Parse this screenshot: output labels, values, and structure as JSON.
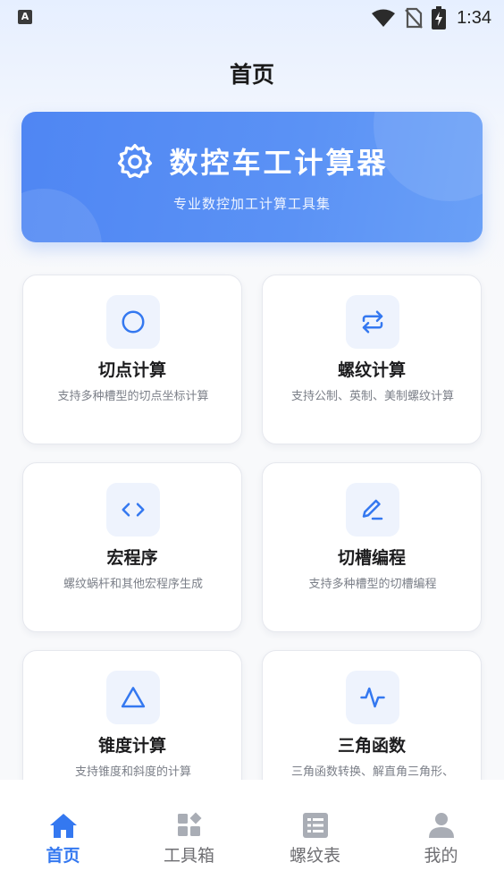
{
  "status_bar": {
    "app_icon_letter": "A",
    "time": "1:34"
  },
  "page": {
    "title": "首页"
  },
  "hero": {
    "title": "数控车工计算器",
    "subtitle": "专业数控加工计算工具集"
  },
  "cards": [
    {
      "title": "切点计算",
      "desc": "支持多种槽型的切点坐标计算",
      "icon": "circle-icon"
    },
    {
      "title": "螺纹计算",
      "desc": "支持公制、英制、美制螺纹计算",
      "icon": "swap-arrows-icon"
    },
    {
      "title": "宏程序",
      "desc": "螺纹蜗杆和其他宏程序生成",
      "icon": "code-icon"
    },
    {
      "title": "切槽编程",
      "desc": "支持多种槽型的切槽编程",
      "icon": "pencil-icon"
    },
    {
      "title": "锥度计算",
      "desc": "支持锥度和斜度的计算",
      "icon": "triangle-icon"
    },
    {
      "title": "三角函数",
      "desc": "三角函数转换、解直角三角形、",
      "icon": "waveform-icon"
    }
  ],
  "bottom_nav": {
    "items": [
      {
        "label": "首页",
        "icon": "home-icon",
        "active": true
      },
      {
        "label": "工具箱",
        "icon": "toolbox-grid-icon",
        "active": false
      },
      {
        "label": "螺纹表",
        "icon": "table-list-icon",
        "active": false
      },
      {
        "label": "我的",
        "icon": "person-icon",
        "active": false
      }
    ]
  },
  "colors": {
    "accent": "#3478f0",
    "hero_blue": "#4f86f3",
    "icon_bg": "#eef3fd",
    "inactive_nav": "#a9adb5"
  }
}
